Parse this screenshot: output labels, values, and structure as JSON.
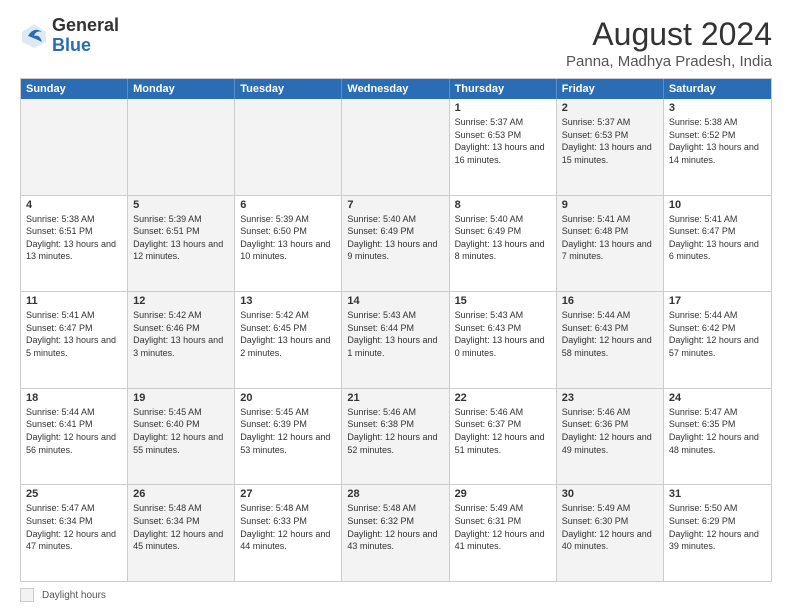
{
  "header": {
    "logo_general": "General",
    "logo_blue": "Blue",
    "month": "August 2024",
    "location": "Panna, Madhya Pradesh, India"
  },
  "days_of_week": [
    "Sunday",
    "Monday",
    "Tuesday",
    "Wednesday",
    "Thursday",
    "Friday",
    "Saturday"
  ],
  "rows": [
    [
      {
        "day": "",
        "text": "",
        "shade": true
      },
      {
        "day": "",
        "text": "",
        "shade": true
      },
      {
        "day": "",
        "text": "",
        "shade": true
      },
      {
        "day": "",
        "text": "",
        "shade": true
      },
      {
        "day": "1",
        "text": "Sunrise: 5:37 AM\nSunset: 6:53 PM\nDaylight: 13 hours and 16 minutes.",
        "shade": false
      },
      {
        "day": "2",
        "text": "Sunrise: 5:37 AM\nSunset: 6:53 PM\nDaylight: 13 hours and 15 minutes.",
        "shade": true
      },
      {
        "day": "3",
        "text": "Sunrise: 5:38 AM\nSunset: 6:52 PM\nDaylight: 13 hours and 14 minutes.",
        "shade": false
      }
    ],
    [
      {
        "day": "4",
        "text": "Sunrise: 5:38 AM\nSunset: 6:51 PM\nDaylight: 13 hours and 13 minutes.",
        "shade": false
      },
      {
        "day": "5",
        "text": "Sunrise: 5:39 AM\nSunset: 6:51 PM\nDaylight: 13 hours and 12 minutes.",
        "shade": true
      },
      {
        "day": "6",
        "text": "Sunrise: 5:39 AM\nSunset: 6:50 PM\nDaylight: 13 hours and 10 minutes.",
        "shade": false
      },
      {
        "day": "7",
        "text": "Sunrise: 5:40 AM\nSunset: 6:49 PM\nDaylight: 13 hours and 9 minutes.",
        "shade": true
      },
      {
        "day": "8",
        "text": "Sunrise: 5:40 AM\nSunset: 6:49 PM\nDaylight: 13 hours and 8 minutes.",
        "shade": false
      },
      {
        "day": "9",
        "text": "Sunrise: 5:41 AM\nSunset: 6:48 PM\nDaylight: 13 hours and 7 minutes.",
        "shade": true
      },
      {
        "day": "10",
        "text": "Sunrise: 5:41 AM\nSunset: 6:47 PM\nDaylight: 13 hours and 6 minutes.",
        "shade": false
      }
    ],
    [
      {
        "day": "11",
        "text": "Sunrise: 5:41 AM\nSunset: 6:47 PM\nDaylight: 13 hours and 5 minutes.",
        "shade": false
      },
      {
        "day": "12",
        "text": "Sunrise: 5:42 AM\nSunset: 6:46 PM\nDaylight: 13 hours and 3 minutes.",
        "shade": true
      },
      {
        "day": "13",
        "text": "Sunrise: 5:42 AM\nSunset: 6:45 PM\nDaylight: 13 hours and 2 minutes.",
        "shade": false
      },
      {
        "day": "14",
        "text": "Sunrise: 5:43 AM\nSunset: 6:44 PM\nDaylight: 13 hours and 1 minute.",
        "shade": true
      },
      {
        "day": "15",
        "text": "Sunrise: 5:43 AM\nSunset: 6:43 PM\nDaylight: 13 hours and 0 minutes.",
        "shade": false
      },
      {
        "day": "16",
        "text": "Sunrise: 5:44 AM\nSunset: 6:43 PM\nDaylight: 12 hours and 58 minutes.",
        "shade": true
      },
      {
        "day": "17",
        "text": "Sunrise: 5:44 AM\nSunset: 6:42 PM\nDaylight: 12 hours and 57 minutes.",
        "shade": false
      }
    ],
    [
      {
        "day": "18",
        "text": "Sunrise: 5:44 AM\nSunset: 6:41 PM\nDaylight: 12 hours and 56 minutes.",
        "shade": false
      },
      {
        "day": "19",
        "text": "Sunrise: 5:45 AM\nSunset: 6:40 PM\nDaylight: 12 hours and 55 minutes.",
        "shade": true
      },
      {
        "day": "20",
        "text": "Sunrise: 5:45 AM\nSunset: 6:39 PM\nDaylight: 12 hours and 53 minutes.",
        "shade": false
      },
      {
        "day": "21",
        "text": "Sunrise: 5:46 AM\nSunset: 6:38 PM\nDaylight: 12 hours and 52 minutes.",
        "shade": true
      },
      {
        "day": "22",
        "text": "Sunrise: 5:46 AM\nSunset: 6:37 PM\nDaylight: 12 hours and 51 minutes.",
        "shade": false
      },
      {
        "day": "23",
        "text": "Sunrise: 5:46 AM\nSunset: 6:36 PM\nDaylight: 12 hours and 49 minutes.",
        "shade": true
      },
      {
        "day": "24",
        "text": "Sunrise: 5:47 AM\nSunset: 6:35 PM\nDaylight: 12 hours and 48 minutes.",
        "shade": false
      }
    ],
    [
      {
        "day": "25",
        "text": "Sunrise: 5:47 AM\nSunset: 6:34 PM\nDaylight: 12 hours and 47 minutes.",
        "shade": false
      },
      {
        "day": "26",
        "text": "Sunrise: 5:48 AM\nSunset: 6:34 PM\nDaylight: 12 hours and 45 minutes.",
        "shade": true
      },
      {
        "day": "27",
        "text": "Sunrise: 5:48 AM\nSunset: 6:33 PM\nDaylight: 12 hours and 44 minutes.",
        "shade": false
      },
      {
        "day": "28",
        "text": "Sunrise: 5:48 AM\nSunset: 6:32 PM\nDaylight: 12 hours and 43 minutes.",
        "shade": true
      },
      {
        "day": "29",
        "text": "Sunrise: 5:49 AM\nSunset: 6:31 PM\nDaylight: 12 hours and 41 minutes.",
        "shade": false
      },
      {
        "day": "30",
        "text": "Sunrise: 5:49 AM\nSunset: 6:30 PM\nDaylight: 12 hours and 40 minutes.",
        "shade": true
      },
      {
        "day": "31",
        "text": "Sunrise: 5:50 AM\nSunset: 6:29 PM\nDaylight: 12 hours and 39 minutes.",
        "shade": false
      }
    ]
  ],
  "footer": {
    "legend_label": "Daylight hours"
  }
}
